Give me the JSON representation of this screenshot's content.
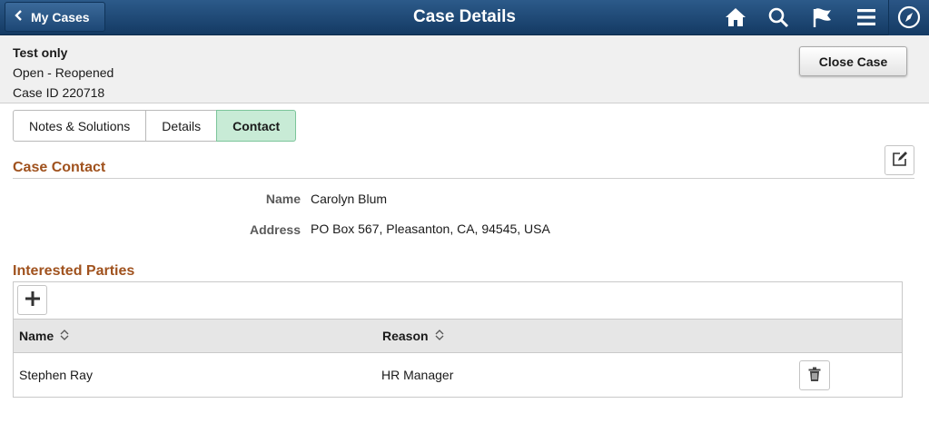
{
  "topbar": {
    "back_label": "My Cases",
    "title": "Case Details",
    "icons": [
      "home-icon",
      "search-icon",
      "flag-icon",
      "menu-icon",
      "navbar-compass-icon"
    ]
  },
  "case": {
    "title": "Test only",
    "status": "Open - Reopened",
    "id_line": "Case ID 220718",
    "close_button": "Close Case"
  },
  "tabs": [
    {
      "label": "Notes & Solutions",
      "active": false
    },
    {
      "label": "Details",
      "active": false
    },
    {
      "label": "Contact",
      "active": true
    }
  ],
  "contact": {
    "section_title": "Case Contact",
    "name_label": "Name",
    "name_value": "Carolyn Blum",
    "address_label": "Address",
    "address_value": "PO Box 567, Pleasanton, CA, 94545, USA"
  },
  "parties": {
    "section_title": "Interested Parties",
    "columns": [
      "Name",
      "Reason"
    ],
    "rows": [
      {
        "name": "Stephen Ray",
        "reason": "HR Manager"
      }
    ]
  },
  "colors": {
    "header_bar": "#1d4775",
    "section_title": "#a0521e",
    "active_tab": "#c8ebd6"
  }
}
